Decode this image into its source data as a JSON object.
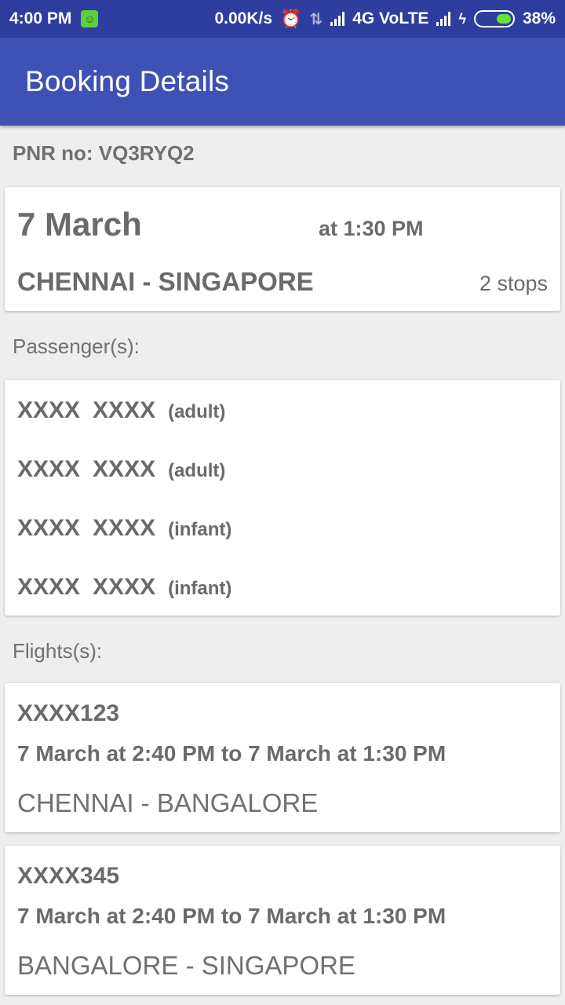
{
  "status_bar": {
    "time": "4:00 PM",
    "speed": "0.00K/s",
    "network": "4G VoLTE",
    "battery": "38%"
  },
  "app_bar": {
    "title": "Booking Details"
  },
  "pnr": "PNR no: VQ3RYQ2",
  "trip": {
    "date": "7 March",
    "time": "at 1:30 PM",
    "route": "CHENNAI - SINGAPORE",
    "stops": "2 stops"
  },
  "passengers_label": "Passenger(s):",
  "passengers": [
    {
      "first": "XXXX",
      "last": "XXXX",
      "type": "(adult)"
    },
    {
      "first": "XXXX",
      "last": "XXXX",
      "type": "(adult)"
    },
    {
      "first": "XXXX",
      "last": "XXXX",
      "type": "(infant)"
    },
    {
      "first": "XXXX",
      "last": "XXXX",
      "type": "(infant)"
    }
  ],
  "flights_label": "Flights(s):",
  "flights": [
    {
      "code": "XXXX123",
      "times": "7 March at 2:40 PM to 7 March at 1:30 PM",
      "route": "CHENNAI - BANGALORE"
    },
    {
      "code": "XXXX345",
      "times": "7 March at 2:40 PM to 7 March at 1:30 PM",
      "route": "BANGALORE - SINGAPORE"
    }
  ],
  "colors": {
    "status_bar": "#2f3e9e",
    "app_bar": "#3f51b5",
    "background": "#eeeeee",
    "text": "#6a6a6a"
  }
}
